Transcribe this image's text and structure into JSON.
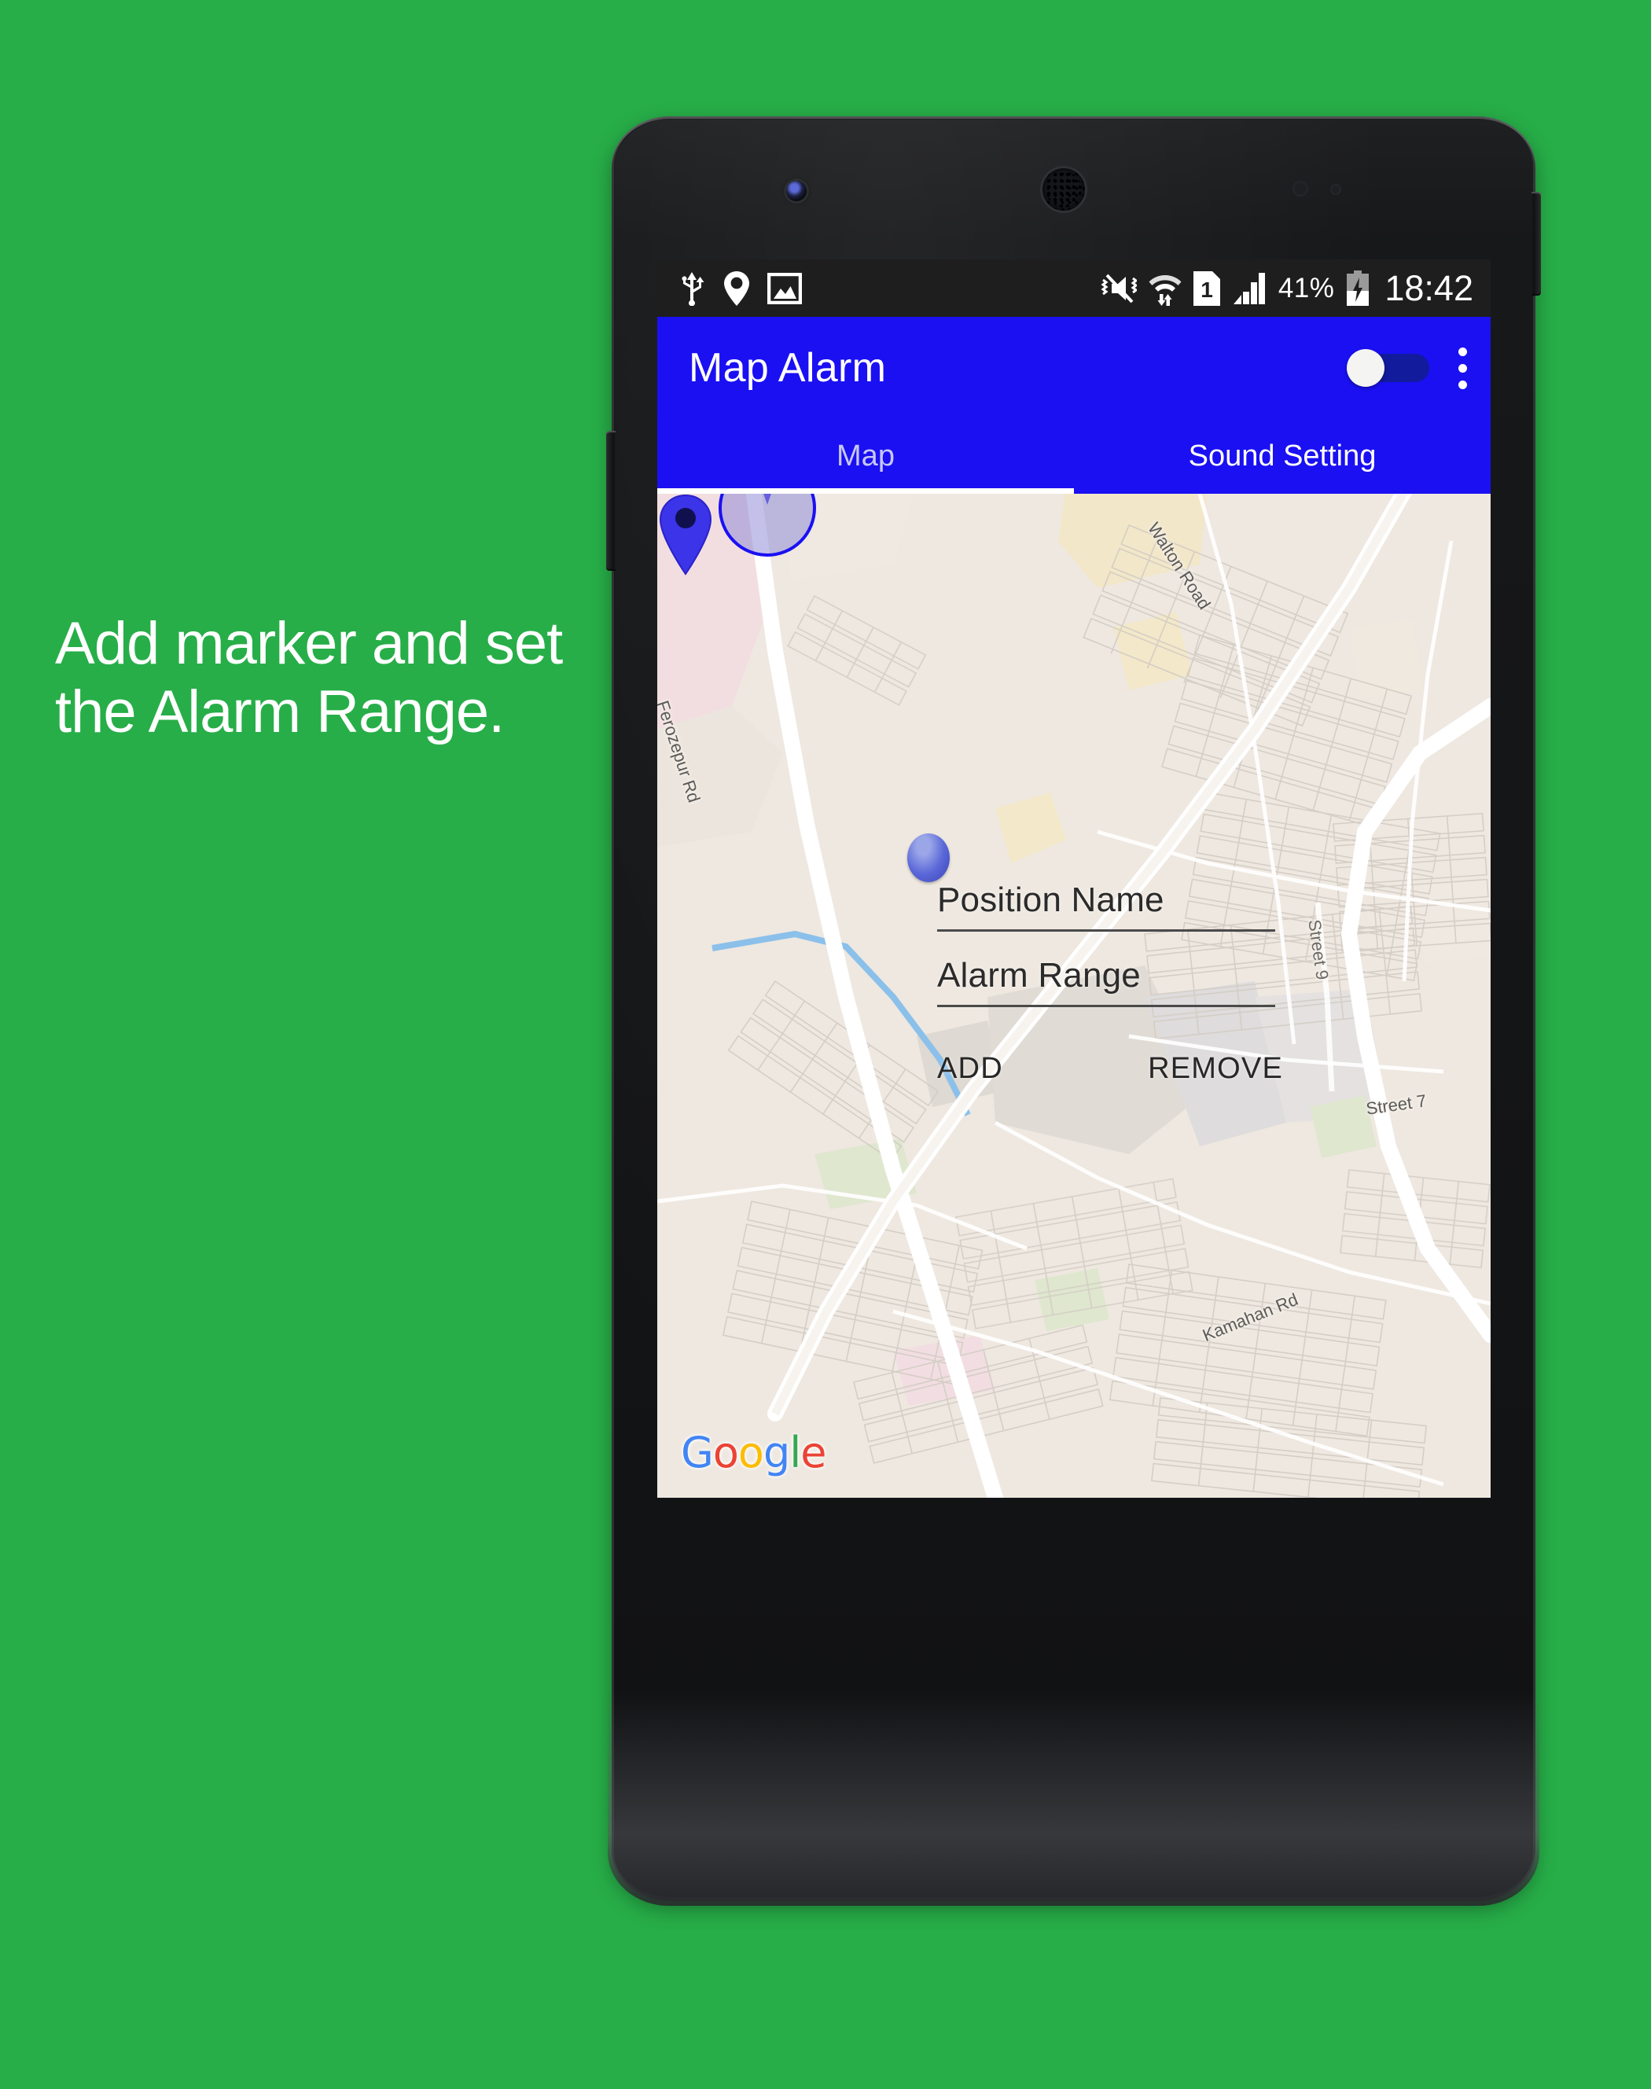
{
  "caption": {
    "text": "Add marker and set the Alarm Range."
  },
  "colors": {
    "background_green": "#27ae48",
    "app_primary_blue": "#1a10f2",
    "statusbar": "#1e1e1e",
    "map_land": "#eee8e0",
    "marker_blue": "#3b34e8"
  },
  "statusbar": {
    "left_icons": [
      "usb-icon",
      "location-pin-icon",
      "screenshot-image-icon"
    ],
    "right_icons": [
      "mute-vibrate-off-icon",
      "wifi-data-icon",
      "sim-1-icon",
      "signal-bars-icon"
    ],
    "battery_percent": "41%",
    "battery_state": "charging",
    "clock": "18:42"
  },
  "appbar": {
    "title": "Map Alarm",
    "switch": {
      "name": "alarm-enable-switch",
      "state": "off"
    },
    "overflow": "more-options"
  },
  "tabs": [
    {
      "label": "Map",
      "selected": true
    },
    {
      "label": "Sound Setting",
      "selected": false
    }
  ],
  "map": {
    "attribution": "Google",
    "attribution_letters": [
      "G",
      "o",
      "o",
      "g",
      "l",
      "e"
    ],
    "labels": [
      {
        "text": "Walton Road"
      },
      {
        "text": "Ferozepur Rd"
      },
      {
        "text": "Street 9"
      },
      {
        "text": "Street 7"
      },
      {
        "text": "Kamahan Rd"
      }
    ],
    "markers": [
      {
        "name": "user-location-circle",
        "kind": "range-circle"
      },
      {
        "name": "position-marker-dot",
        "kind": "circle-marker"
      },
      {
        "name": "alarm-pin",
        "kind": "pin"
      }
    ]
  },
  "form": {
    "position_name": {
      "value": "",
      "placeholder": "Position Name"
    },
    "alarm_range": {
      "value": "",
      "placeholder": "Alarm Range"
    },
    "buttons": {
      "add": "ADD",
      "remove": "REMOVE"
    }
  }
}
